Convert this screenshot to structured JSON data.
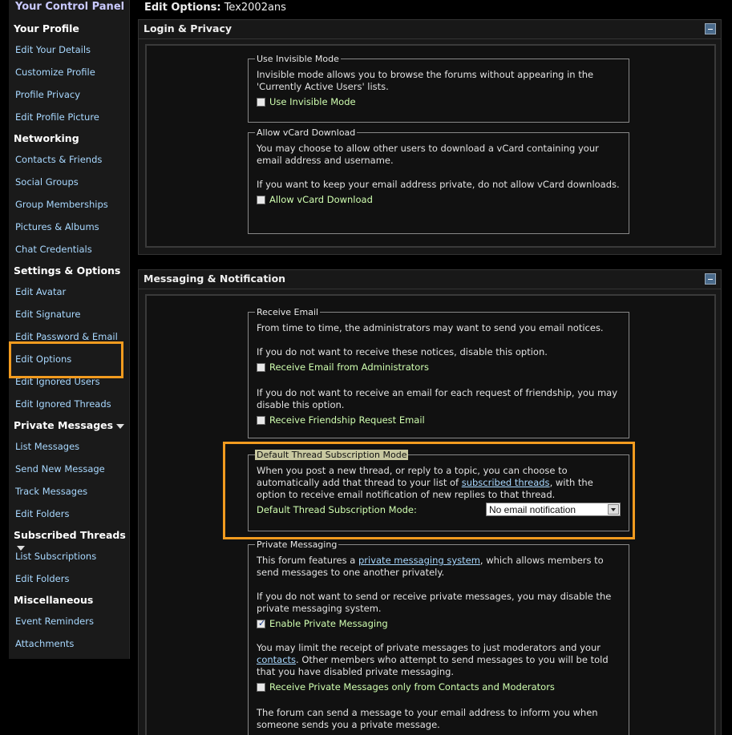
{
  "sidebar": {
    "title": "Your Control Panel",
    "sections": [
      {
        "label": "Your Profile",
        "items": [
          "Edit Your Details",
          "Customize Profile",
          "Profile Privacy",
          "Edit Profile Picture"
        ]
      },
      {
        "label": "Networking",
        "items": [
          "Contacts & Friends",
          "Social Groups",
          "Group Memberships",
          "Pictures & Albums",
          "Chat Credentials"
        ]
      },
      {
        "label": "Settings & Options",
        "items": [
          "Edit Avatar",
          "Edit Signature",
          "Edit Password & Email",
          "Edit Options",
          "Edit Ignored Users",
          "Edit Ignored Threads"
        ]
      },
      {
        "label": "Private Messages",
        "items": [
          "List Messages",
          "Send New Message",
          "Track Messages",
          "Edit Folders"
        ]
      },
      {
        "label": "Subscribed Threads",
        "items": [
          "List Subscriptions",
          "Edit Folders"
        ]
      },
      {
        "label": "Miscellaneous",
        "items": [
          "Event Reminders",
          "Attachments"
        ]
      }
    ],
    "selected_item": "Edit Options"
  },
  "page": {
    "title_label": "Edit Options:",
    "username": "Tex2002ans"
  },
  "login_privacy": {
    "heading": "Login & Privacy",
    "invisible": {
      "legend": "Use Invisible Mode",
      "text": "Invisible mode allows you to browse the forums without appearing in the 'Currently Active Users' lists.",
      "checkbox_label": "Use Invisible Mode",
      "checked": false
    },
    "vcard": {
      "legend": "Allow vCard Download",
      "text1": "You may choose to allow other users to download a vCard containing your email address and username.",
      "text2": "If you want to keep your email address private, do not allow vCard downloads.",
      "checkbox_label": "Allow vCard Download",
      "checked": false
    }
  },
  "messaging": {
    "heading": "Messaging & Notification",
    "receive_email": {
      "legend": "Receive Email",
      "text1": "From time to time, the administrators may want to send you email notices.",
      "text2": "If you do not want to receive these notices, disable this option.",
      "checkbox1_label": "Receive Email from Administrators",
      "checkbox1_checked": false,
      "text3": "If you do not want to receive an email for each request of friendship, you may disable this option.",
      "checkbox2_label": "Receive Friendship Request Email",
      "checkbox2_checked": false
    },
    "subscription": {
      "legend": "Default Thread Subscription Mode",
      "text_before": "When you post a new thread, or reply to a topic, you can choose to automatically add that thread to your list of ",
      "link": "subscribed threads",
      "text_after": ", with the option to receive email notification of new replies to that thread.",
      "select_label": "Default Thread Subscription Mode:",
      "select_value": "No email notification"
    },
    "private_messaging": {
      "legend": "Private Messaging",
      "text1_before": "This forum features a ",
      "text1_link": "private messaging system",
      "text1_after": ", which allows members to send messages to one another privately.",
      "text2": "If you do not want to send or receive private messages, you may disable the private messaging system.",
      "checkbox1_label": "Enable Private Messaging",
      "checkbox1_checked": true,
      "text3_before": "You may limit the receipt of private messages to just moderators and your ",
      "text3_link": "contacts",
      "text3_after": ". Other members who attempt to send messages to you will be told that you have disabled private messaging.",
      "checkbox2_label": "Receive Private Messages only from Contacts and Moderators",
      "checkbox2_checked": false,
      "text4": "The forum can send a message to your email address to inform you when someone sends you a private message."
    }
  },
  "colors": {
    "highlight": "#f29b1f",
    "link": "#a8d8ff",
    "checkbox_label": "#d0ffb0"
  }
}
